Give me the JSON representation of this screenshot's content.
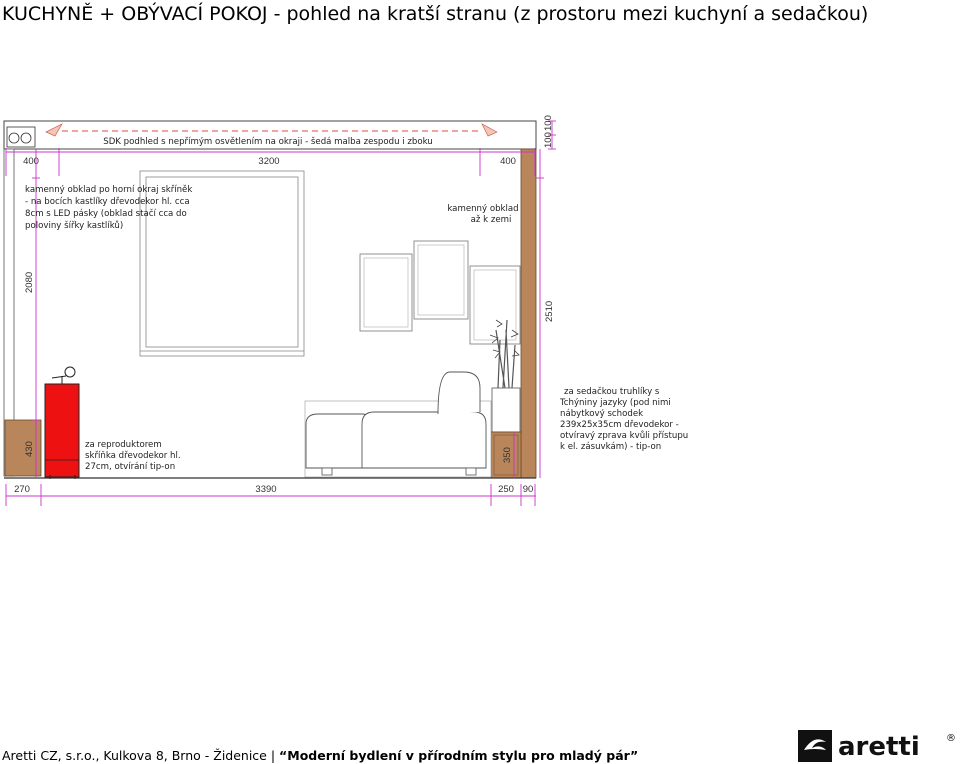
{
  "title": "KUCHYNĚ + OBÝVACÍ POKOJ - pohled na kratší stranu (z prostoru mezi kuchyní a sedačkou)",
  "labels": {
    "ceiling_note": "SDK podhled s nepřímým osvětlením na okraji - šedá malba zespodu i zboku",
    "stone_note_lines": [
      "kamenný obklad po horní okraj skříněk",
      "- na bocích kastlíky dřevodekor hl. cca",
      "8cm s LED pásky (obklad stačí cca do",
      "poloviny šířky kastlíků)"
    ],
    "stone_floor_lines": [
      "kamenný obklad",
      "až k zemi"
    ],
    "speaker_lines": [
      "za reproduktorem",
      "skříňka dřevodekor hl.",
      "27cm, otvírání tip-on"
    ],
    "planter_lines": [
      "za sedačkou truhlíky s",
      "Tchýniny jazyky (pod nimi",
      "nábytkový schodek",
      "239x25x35cm dřevodekor -",
      "otvíravý zprava kvůli přístupu",
      "k el. zásuvkám) - tip-on"
    ]
  },
  "dimensions": {
    "top_left": "400",
    "top_mid": "3200",
    "top_right": "400",
    "right_top_a": "100",
    "right_top_b": "100",
    "left_height": "2080",
    "right_height": "2510",
    "cabinet_height": "430",
    "planter_height": "350",
    "bottom_a": "270",
    "bottom_b": "3390",
    "bottom_c": "250",
    "bottom_d": "90"
  },
  "footer": {
    "company": "Aretti CZ, s.r.o.,  Kulkova 8, Brno - Židenice | ",
    "slogan": "“Moderní bydlení v přírodním stylu pro mladý pár”"
  },
  "logo": {
    "text": "aretti",
    "mark": "®"
  },
  "colors": {
    "dimension_line": "#cc33cc",
    "wood": "#b8865a",
    "red_cabinet": "#ee1111",
    "ceiling_dash": "#e07060"
  }
}
